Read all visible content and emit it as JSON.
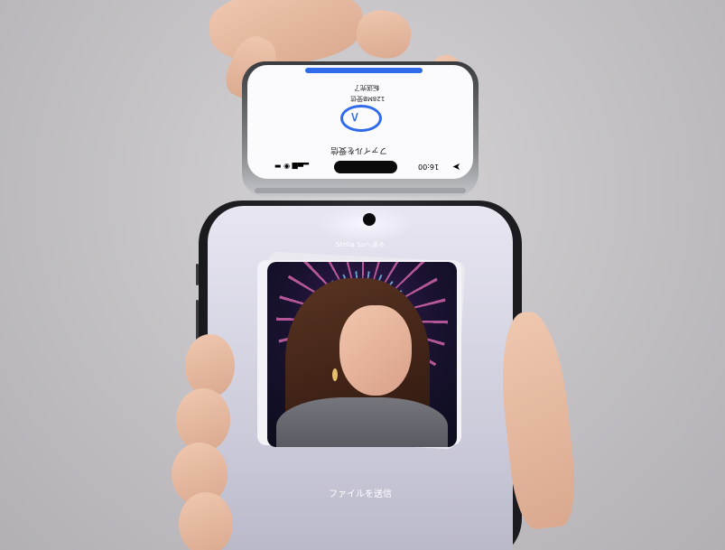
{
  "top_phone": {
    "title": "ファイルを受信",
    "line1": "転送完了",
    "line2": "128MB受信",
    "time": "16:00"
  },
  "bottom_phone": {
    "send_to": "Stella Suへ送る",
    "send_file": "ファイルを送信"
  },
  "colors": {
    "accent": "#2f6bea",
    "background": "#c6c3c7"
  }
}
